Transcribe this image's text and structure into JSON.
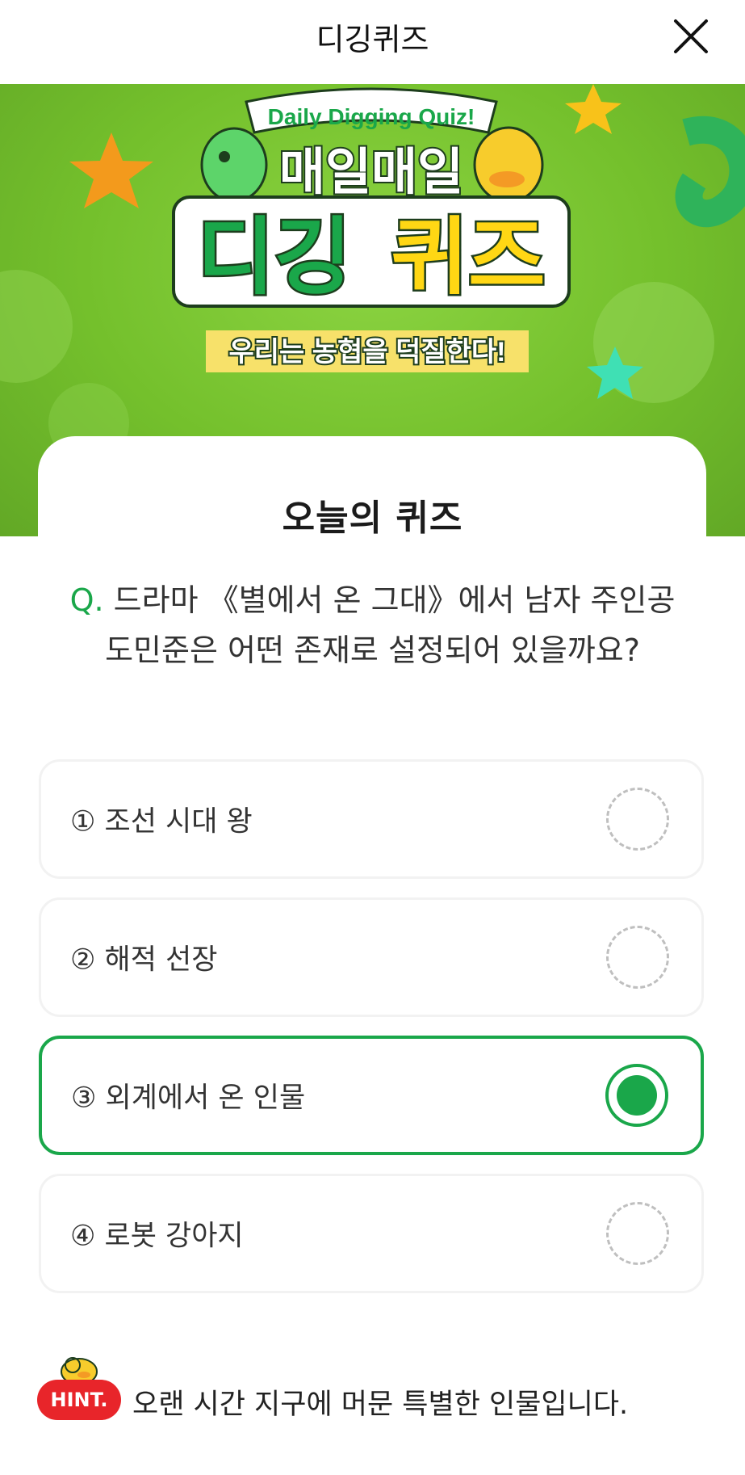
{
  "header": {
    "title": "디깅퀴즈",
    "close_icon": "close-icon"
  },
  "banner": {
    "ribbon_text": "Daily Digging Quiz!",
    "headline_1": "매일매일",
    "headline_2a": "디깅",
    "headline_2b": "퀴즈",
    "tagline": "우리는 농협을 덕질한다!"
  },
  "card": {
    "heading": "오늘의 퀴즈"
  },
  "question": {
    "prefix": "Q.",
    "text": "드라마 《별에서 온 그대》에서 남자 주인공 도민준은 어떤 존재로 설정되어 있을까요?"
  },
  "options": [
    {
      "label": "① 조선 시대 왕",
      "selected": false
    },
    {
      "label": "② 해적 선장",
      "selected": false
    },
    {
      "label": "③ 외계에서 온 인물",
      "selected": true
    },
    {
      "label": "④ 로봇 강아지",
      "selected": false
    }
  ],
  "hint": {
    "badge": "HINT.",
    "text": "오랜 시간 지구에 머문 특별한 인물입니다."
  },
  "colors": {
    "accent": "#1aa74a",
    "banner_green": "#74c02c",
    "hint_red": "#e8252a"
  }
}
